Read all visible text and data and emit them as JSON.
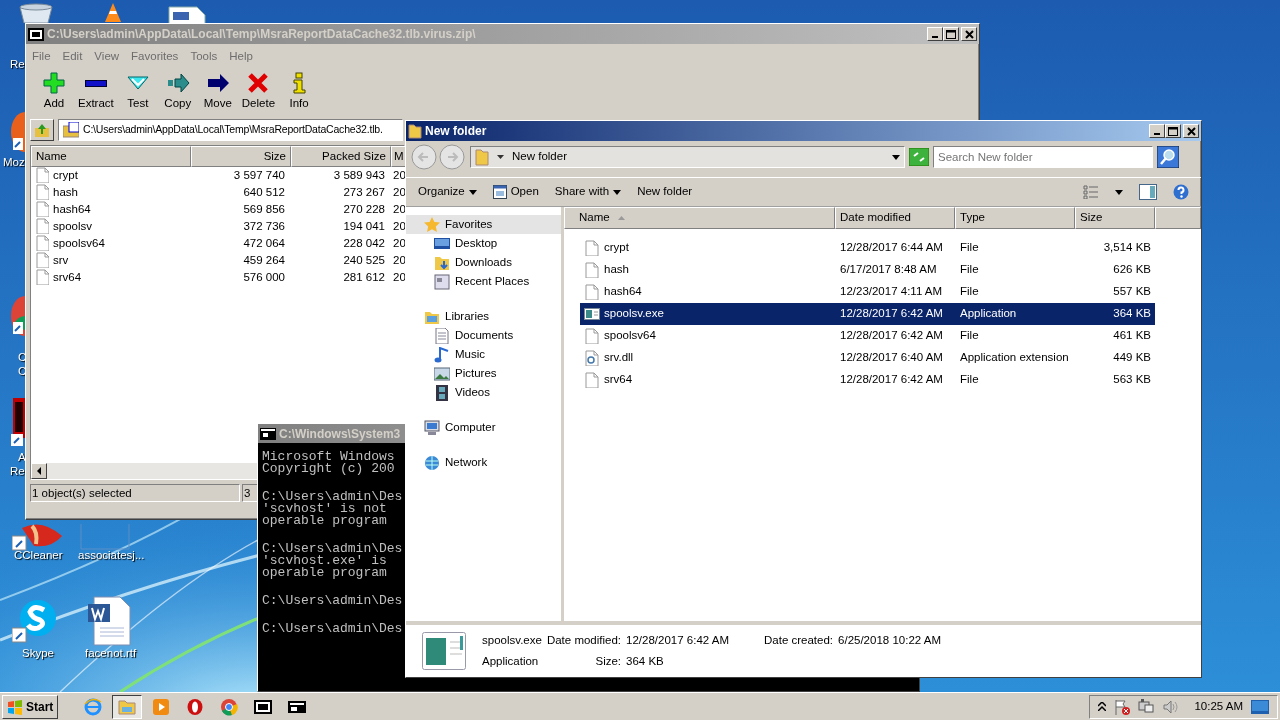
{
  "desktop": {
    "icons": [
      {
        "kind": "recycle",
        "lines": [
          "Re"
        ]
      },
      {
        "kind": "cone"
      },
      {
        "kind": "document"
      },
      {
        "kind": "browser",
        "lines": [
          "Moz"
        ]
      },
      {
        "kind": "globe",
        "lines": [
          "C",
          "C"
        ]
      },
      {
        "kind": "reader",
        "lines": [
          "A",
          "Re"
        ]
      },
      {
        "kind": "cleaner",
        "lines": [
          "CCleaner"
        ]
      },
      {
        "kind": "blank",
        "lines": [
          "associatesj..."
        ]
      },
      {
        "kind": "skype",
        "lines": [
          "Skype"
        ]
      },
      {
        "kind": "word",
        "lines": [
          "facenot.rtf"
        ]
      }
    ]
  },
  "archive_window": {
    "title": "C:\\Users\\admin\\AppData\\Local\\Temp\\MsraReportDataCache32.tlb.virus.zip\\",
    "menu": [
      "File",
      "Edit",
      "View",
      "Favorites",
      "Tools",
      "Help"
    ],
    "toolbar": [
      {
        "kind": "add",
        "label": "Add"
      },
      {
        "kind": "extract",
        "label": "Extract"
      },
      {
        "kind": "test",
        "label": "Test"
      },
      {
        "kind": "copy",
        "label": "Copy"
      },
      {
        "kind": "move",
        "label": "Move"
      },
      {
        "kind": "delete",
        "label": "Delete"
      },
      {
        "kind": "info",
        "label": "Info"
      }
    ],
    "address": "C:\\Users\\admin\\AppData\\Local\\Temp\\MsraReportDataCache32.tlb.",
    "columns": [
      "Name",
      "Size",
      "Packed Size",
      "M"
    ],
    "rows": [
      {
        "name": "crypt",
        "size": "3 597 740",
        "packed_size": "3 589 943",
        "column_4": "20"
      },
      {
        "name": "hash",
        "size": "640 512",
        "packed_size": "273 267",
        "column_4": "20"
      },
      {
        "name": "hash64",
        "size": "569 856",
        "packed_size": "270 228",
        "column_4": "20"
      },
      {
        "name": "spoolsv",
        "size": "372 736",
        "packed_size": "194 041",
        "column_4": "20"
      },
      {
        "name": "spoolsv64",
        "size": "472 064",
        "packed_size": "228 042",
        "column_4": "20"
      },
      {
        "name": "srv",
        "size": "459 264",
        "packed_size": "240 525",
        "column_4": "20"
      },
      {
        "name": "srv64",
        "size": "576 000",
        "packed_size": "281 612",
        "column_4": "20"
      }
    ],
    "status": [
      "1 object(s) selected",
      "3"
    ]
  },
  "console_window": {
    "title": "C:\\Windows\\System3",
    "paragraphs": [
      [
        "Microsoft Windows",
        "Copyright (c) 200"
      ],
      [
        "C:\\Users\\admin\\Des",
        "'scvhost' is not",
        "operable program"
      ],
      [
        "C:\\Users\\admin\\Des",
        "'scvhost.exe' is",
        "operable program"
      ],
      [
        "C:\\Users\\admin\\Des"
      ],
      [
        "C:\\Users\\admin\\Des"
      ]
    ]
  },
  "explorer_window": {
    "title": "New folder",
    "breadcrumb": "New folder",
    "search": {
      "placeholder": "Search New folder"
    },
    "commands": [
      {
        "label": "Organize",
        "kind": "menu"
      },
      {
        "label": "Open",
        "kind": "open"
      },
      {
        "label": "Share with",
        "kind": "menu"
      },
      {
        "label": "New folder",
        "kind": "plain"
      }
    ],
    "navigation": [
      {
        "label": "Favorites",
        "kind": "star",
        "selected": true,
        "children": [
          {
            "label": "Desktop",
            "kind": "desktop",
            "selected": false
          },
          {
            "label": "Downloads",
            "kind": "downloads",
            "selected": false
          },
          {
            "label": "Recent Places",
            "kind": "recent",
            "selected": false
          }
        ]
      },
      {
        "label": "Libraries",
        "kind": "libraries",
        "selected": false,
        "children": [
          {
            "label": "Documents",
            "kind": "documents",
            "selected": false
          },
          {
            "label": "Music",
            "kind": "music",
            "selected": false
          },
          {
            "label": "Pictures",
            "kind": "pictures",
            "selected": false
          },
          {
            "label": "Videos",
            "kind": "videos",
            "selected": false
          }
        ]
      },
      {
        "label": "Computer",
        "kind": "computer",
        "selected": false
      },
      {
        "label": "Network",
        "kind": "network",
        "selected": false
      }
    ],
    "columns": [
      "Name",
      "Date modified",
      "Type",
      "Size"
    ],
    "rows": [
      {
        "name": "crypt",
        "kind": "file",
        "date_modified": "12/28/2017 6:44 AM",
        "type": "File",
        "size": "3,514 KB",
        "selected": false
      },
      {
        "name": "hash",
        "kind": "file",
        "date_modified": "6/17/2017 8:48 AM",
        "type": "File",
        "size": "626 KB",
        "selected": false
      },
      {
        "name": "hash64",
        "kind": "file",
        "date_modified": "12/23/2017 4:11 AM",
        "type": "File",
        "size": "557 KB",
        "selected": false
      },
      {
        "name": "spoolsv.exe",
        "kind": "exe",
        "date_modified": "12/28/2017 6:42 AM",
        "type": "Application",
        "size": "364 KB",
        "selected": true
      },
      {
        "name": "spoolsv64",
        "kind": "file",
        "date_modified": "12/28/2017 6:42 AM",
        "type": "File",
        "size": "461 KB",
        "selected": false
      },
      {
        "name": "srv.dll",
        "kind": "dll",
        "date_modified": "12/28/2017 6:40 AM",
        "type": "Application extension",
        "size": "449 KB",
        "selected": false
      },
      {
        "name": "srv64",
        "kind": "file",
        "date_modified": "12/28/2017 6:42 AM",
        "type": "File",
        "size": "563 KB",
        "selected": false
      }
    ],
    "details": {
      "name": "spoolsv.exe",
      "type": "Application",
      "modified_label": "Date modified:",
      "modified": "12/28/2017 6:42 AM",
      "created_label": "Date created:",
      "created": "6/25/2018 10:22 AM",
      "size_label": "Size:",
      "size": "364 KB"
    }
  },
  "taskbar": {
    "start": "Start",
    "apps": [
      {
        "kind": "ie",
        "selected": false
      },
      {
        "kind": "folder",
        "selected": true
      },
      {
        "kind": "player",
        "selected": false
      },
      {
        "kind": "opera",
        "selected": false
      },
      {
        "kind": "chrome",
        "selected": false
      },
      {
        "kind": "archiver",
        "selected": false
      },
      {
        "kind": "console",
        "selected": false
      }
    ],
    "clock": "10:25 AM"
  }
}
